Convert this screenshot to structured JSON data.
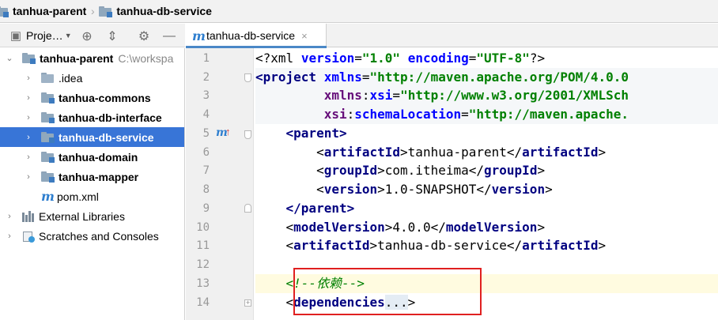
{
  "breadcrumb": {
    "items": [
      "tanhua-parent",
      "tanhua-db-service"
    ]
  },
  "project_panel": {
    "title": "Proje…",
    "icons": [
      "project-icon",
      "locate-icon",
      "collapse-icon",
      "gear-icon",
      "minimize-icon"
    ],
    "tree": [
      {
        "label": "tanhua-parent",
        "path": "C:\\workspa",
        "type": "module",
        "expanded": true
      },
      {
        "label": ".idea",
        "type": "folder"
      },
      {
        "label": "tanhua-commons",
        "type": "module"
      },
      {
        "label": "tanhua-db-interface",
        "type": "module"
      },
      {
        "label": "tanhua-db-service",
        "type": "module",
        "selected": true
      },
      {
        "label": "tanhua-domain",
        "type": "module"
      },
      {
        "label": "tanhua-mapper",
        "type": "module"
      },
      {
        "label": "pom.xml",
        "type": "maven-file"
      },
      {
        "label": "External Libraries",
        "type": "libraries"
      },
      {
        "label": "Scratches and Consoles",
        "type": "scratches"
      }
    ]
  },
  "editor": {
    "tab": {
      "label": "tanhua-db-service",
      "close": "×"
    },
    "line_numbers": [
      "1",
      "2",
      "3",
      "4",
      "5",
      "6",
      "7",
      "8",
      "9",
      "10",
      "11",
      "12",
      "13",
      "14"
    ],
    "code": {
      "l1_decl": "<?xml",
      "l1_version_attr": "version",
      "l1_version_val": "\"1.0\"",
      "l1_encoding_attr": "encoding",
      "l1_encoding_val": "\"UTF-8\"",
      "l1_end": "?>",
      "l2_tag": "<project",
      "l2_attr": "xmlns",
      "l2_val": "\"http://maven.apache.org/POM/4.0.0",
      "l3_ns": "xmlns",
      "l3_attr": "xsi",
      "l3_val": "\"http://www.w3.org/2001/XMLSch",
      "l4_ns": "xsi",
      "l4_attr": "schemaLocation",
      "l4_val": "\"http://maven.apache.",
      "l5_open": "<parent>",
      "l6_tag": "artifactId",
      "l6_value": "tanhua-parent",
      "l7_tag": "groupId",
      "l7_value": "com.itheima",
      "l8_tag": "version",
      "l8_value": "1.0-SNAPSHOT",
      "l9_close": "</parent>",
      "l10_tag": "modelVersion",
      "l10_value": "4.0.0",
      "l11_tag": "artifactId",
      "l11_value": "tanhua-db-service",
      "l13_comment_start": "<!--",
      "l13_comment_text": "依赖",
      "l13_comment_end": "-->",
      "l14_tag": "dependencies",
      "l14_folded": "..."
    }
  }
}
